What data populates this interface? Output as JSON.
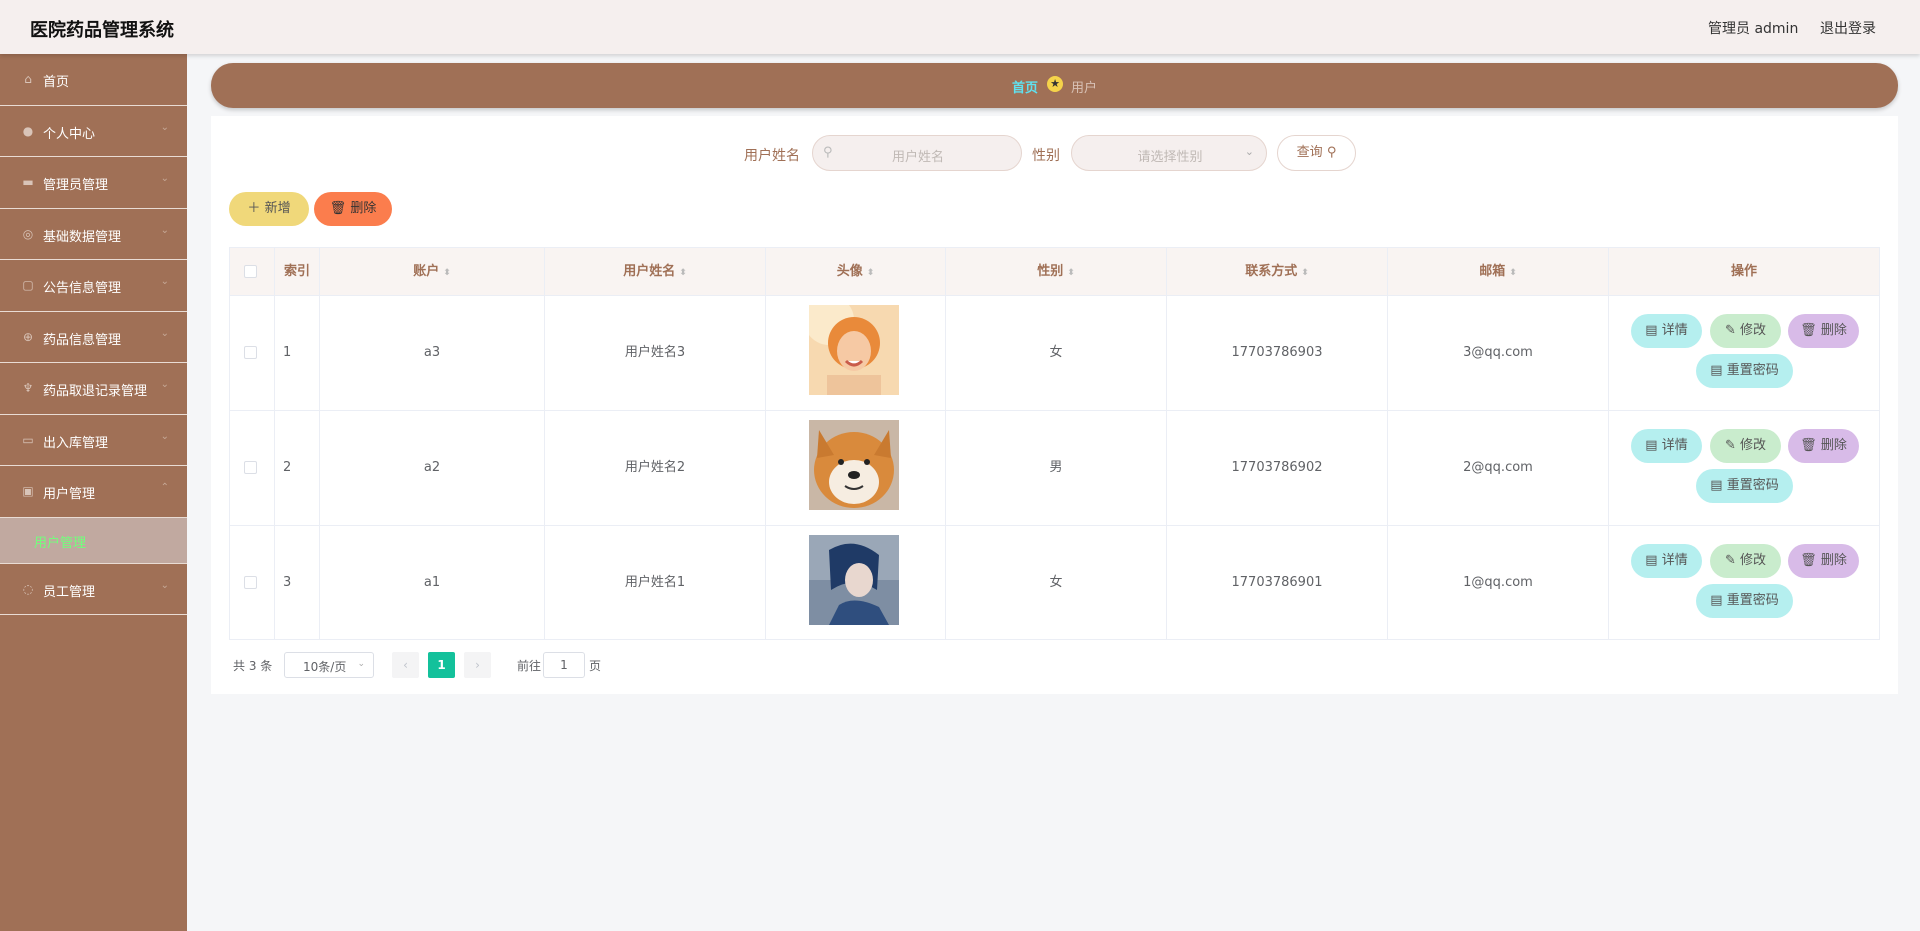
{
  "header": {
    "title": "医院药品管理系统",
    "admin": "管理员 admin",
    "logout": "退出登录"
  },
  "sidebar": {
    "items": [
      {
        "label": "首页",
        "icon": "home-icon"
      },
      {
        "label": "个人中心",
        "icon": "user-icon"
      },
      {
        "label": "管理员管理",
        "icon": "admin-icon"
      },
      {
        "label": "基础数据管理",
        "icon": "globe-icon"
      },
      {
        "label": "公告信息管理",
        "icon": "document-icon"
      },
      {
        "label": "药品信息管理",
        "icon": "basketball-icon"
      },
      {
        "label": "药品取退记录管理",
        "icon": "trophy-icon"
      },
      {
        "label": "出入库管理",
        "icon": "box-icon"
      },
      {
        "label": "用户管理",
        "icon": "lock-icon"
      }
    ],
    "active_sub": "用户管理",
    "last_item": {
      "label": "员工管理",
      "icon": "loading-icon"
    }
  },
  "breadcrumb": {
    "home": "首页",
    "current": "用户"
  },
  "search": {
    "name_label": "用户姓名",
    "name_placeholder": "用户姓名",
    "gender_label": "性别",
    "gender_placeholder": "请选择性别",
    "query": "查询"
  },
  "actions": {
    "add": "新增",
    "delete": "删除"
  },
  "table": {
    "columns": [
      "索引",
      "账户",
      "用户姓名",
      "头像",
      "性别",
      "联系方式",
      "邮箱",
      "操作"
    ],
    "rows": [
      {
        "index": "1",
        "account": "a3",
        "name": "用户姓名3",
        "gender": "女",
        "phone": "17703786903",
        "email": "3@qq.com"
      },
      {
        "index": "2",
        "account": "a2",
        "name": "用户姓名2",
        "gender": "男",
        "phone": "17703786902",
        "email": "2@qq.com"
      },
      {
        "index": "3",
        "account": "a1",
        "name": "用户姓名1",
        "gender": "女",
        "phone": "17703786901",
        "email": "1@qq.com"
      }
    ],
    "ops": {
      "detail": "详情",
      "edit": "修改",
      "delete": "删除",
      "reset": "重置密码"
    }
  },
  "pagination": {
    "total": "共 3 条",
    "page_size": "10条/页",
    "current": "1",
    "goto": "前往",
    "goto_value": "1",
    "page_unit": "页"
  },
  "colors": {
    "brand": "#a07056",
    "active_green": "#13c19b",
    "sub_active_text": "#72ff7c",
    "breadcrumb_home": "#5fe2f0"
  }
}
